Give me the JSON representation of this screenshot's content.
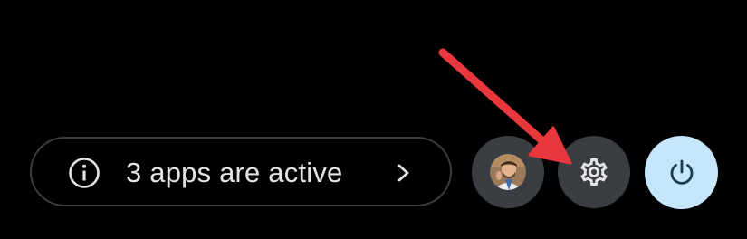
{
  "quick_settings": {
    "status_text": "3 apps are active",
    "status_icon": "info-icon",
    "status_chevron": "chevron-right-icon",
    "avatar_icon": "user-avatar",
    "settings_icon": "gear-icon",
    "power_icon": "power-icon"
  },
  "annotation": {
    "arrow_icon": "red-arrow-pointer",
    "arrow_target": "settings-button"
  },
  "colors": {
    "background": "#000000",
    "pill_border": "#3a3d41",
    "button_bg": "#3a3d41",
    "power_bg": "#c6e6fb",
    "icon_light": "#e3e3e3",
    "power_icon": "#1f3a4d",
    "arrow": "#e8383d"
  }
}
